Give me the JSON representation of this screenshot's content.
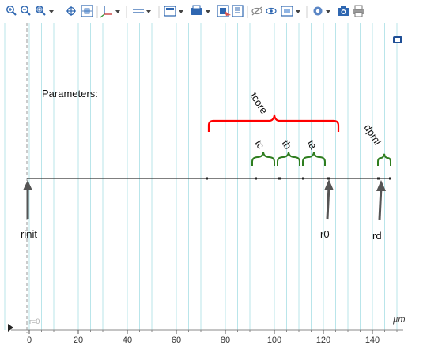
{
  "toolbar": {
    "left_group": [
      "zoom-in-icon",
      "zoom-out-icon",
      "zoom-box-icon",
      "zoom-extents-icon",
      "zoom-selected-icon",
      "axis-icon"
    ],
    "middle_group": [
      "line-style-icon",
      "plot-group-icon",
      "print-plot-icon",
      "export-image-icon",
      "hide-icon",
      "view-icon",
      "selection-icon"
    ],
    "right_group": [
      "settings-icon",
      "camera-icon",
      "printer-icon"
    ]
  },
  "plot": {
    "parameters_label": "Parameters:",
    "groups": {
      "tcore": "tcore",
      "tc": "tc",
      "tb": "tb",
      "ta": "ta",
      "dpml": "dpml"
    },
    "arrows": {
      "rinit": "rinit",
      "r0": "r0",
      "rd": "rd"
    },
    "corner_label": "r=0",
    "unit_label": "µm",
    "x_ticks": [
      "0",
      "20",
      "40",
      "60",
      "80",
      "100",
      "120",
      "140"
    ],
    "colors": {
      "tcore_brace": "#ff0000",
      "small_braces": "#2e7d1e",
      "grid": "#b9e5ea",
      "axis_line": "#333333",
      "arrow": "#555555"
    }
  }
}
